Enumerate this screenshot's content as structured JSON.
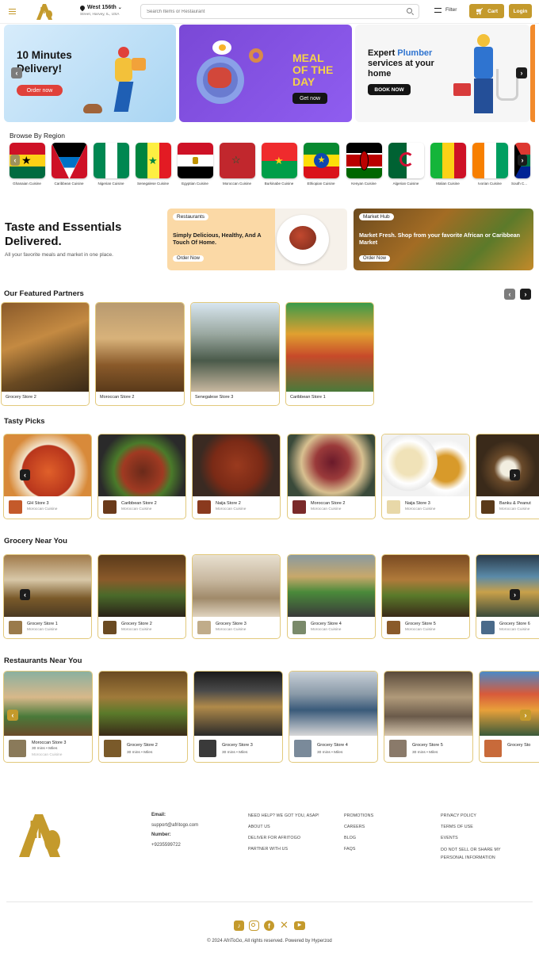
{
  "header": {
    "location_title": "West 156th",
    "location_sub": "Street, Harvey, IL, USA",
    "search_placeholder": "Search Items or Restaurant",
    "filter_label": "Filter",
    "cart_label": "Cart",
    "login_label": "Login"
  },
  "banners": {
    "delivery_title": "10 Minutes Delivery!",
    "delivery_cta": "Order now",
    "meal_line1": "MEAL",
    "meal_line2": "OF THE",
    "meal_line3": "DAY",
    "meal_cta": "Get now",
    "plumber_pre": "Expert ",
    "plumber_accent": "Plumber",
    "plumber_rest": "services at your home",
    "plumber_cta": "BOOK NOW"
  },
  "regions": {
    "title": "Browse By Region",
    "items": [
      "Ghanaian Cuisine",
      "Caribbean Cuisine",
      "Nigerian Cuisine",
      "Senegalese Cuisine",
      "Egyptian Cuisine",
      "Moroccan Cuisine",
      "Burkinabe Cuisine",
      "Ethiopian Cuisine",
      "Kenyan Cuisine",
      "Algerian Cuisine",
      "Malian Cuisine",
      "Ivorian Cuisine",
      "South C..."
    ]
  },
  "hero": {
    "title": "Taste and Essentials Delivered.",
    "subtitle": "All your favorite meals and market in one place.",
    "restaurants_tag": "Restaurants",
    "restaurants_text": "Simply Delicious, Healthy, And A Touch Of Home.",
    "restaurants_cta": "Order Now",
    "market_tag": "Market Hub",
    "market_text": "Market Fresh. Shop from your favorite African or Caribbean Market",
    "market_cta": "Order Now"
  },
  "featured": {
    "title": "Our Featured Partners",
    "items": [
      "Grocery Store 2",
      "Moroccan Store 2",
      "Senegalese Store 3",
      "Caribbean Store 1"
    ]
  },
  "tasty": {
    "title": "Tasty Picks",
    "items": [
      {
        "name": "GH Store 3",
        "sub": "Moroccan Cuisine"
      },
      {
        "name": "Caribbean Store 2",
        "sub": "Moroccan Cuisine"
      },
      {
        "name": "Naija Store 2",
        "sub": "Moroccan Cuisine"
      },
      {
        "name": "Moroccan Store 2",
        "sub": "Moroccan Cuisine"
      },
      {
        "name": "Naija Store 3",
        "sub": "Moroccan Cuisine"
      },
      {
        "name": "Banku & Peanut",
        "sub": "Moroccan Cuisine"
      }
    ]
  },
  "grocery": {
    "title": "Grocery Near You",
    "items": [
      {
        "name": "Grocery Store 1",
        "sub": "Moroccan Cuisine"
      },
      {
        "name": "Grocery Store 2",
        "sub": "Moroccan Cuisine"
      },
      {
        "name": "Grocery Store 3",
        "sub": "Moroccan Cuisine"
      },
      {
        "name": "Grocery Store 4",
        "sub": "Moroccan Cuisine"
      },
      {
        "name": "Grocery Store 5",
        "sub": "Moroccan Cuisine"
      },
      {
        "name": "Grocery Store 6",
        "sub": "Moroccan Cuisine"
      }
    ]
  },
  "restaurants": {
    "title": "Restaurants Near You",
    "mins": "30 mins",
    "miles": "Miles",
    "extra_sub": "Moroccan Cuisine",
    "items": [
      "Moroccan Store 3",
      "Grocery Store 2",
      "Grocery Store 3",
      "Grocery Store 4",
      "Grocery Store 5",
      "Grocery Sto"
    ]
  },
  "footer": {
    "email_label": "Email:",
    "email": "support@afritogo.com",
    "number_label": "Number:",
    "number": "+9235599722",
    "col1": [
      "NEED HELP? WE GOT YOU, ASAP!",
      "ABOUT US",
      "DELIVER FOR AFRITOGO",
      "PARTNER WITH US"
    ],
    "col2": [
      "PROMOTIONS",
      "CAREERS",
      "BLOG",
      "FAQS"
    ],
    "col3": [
      "PRIVACY POLICY",
      "TERMS OF USE",
      "EVENTS",
      "DO NOT SELL OR SHARE MY PERSONAL INFORMATION"
    ],
    "copyright": "© 2024 AfriToGo, All rights reserved. Powered by Hyperzod"
  },
  "colors": {
    "brand": "#c49a2c",
    "dark": "#1c1c1c",
    "red": "#e0413a"
  }
}
